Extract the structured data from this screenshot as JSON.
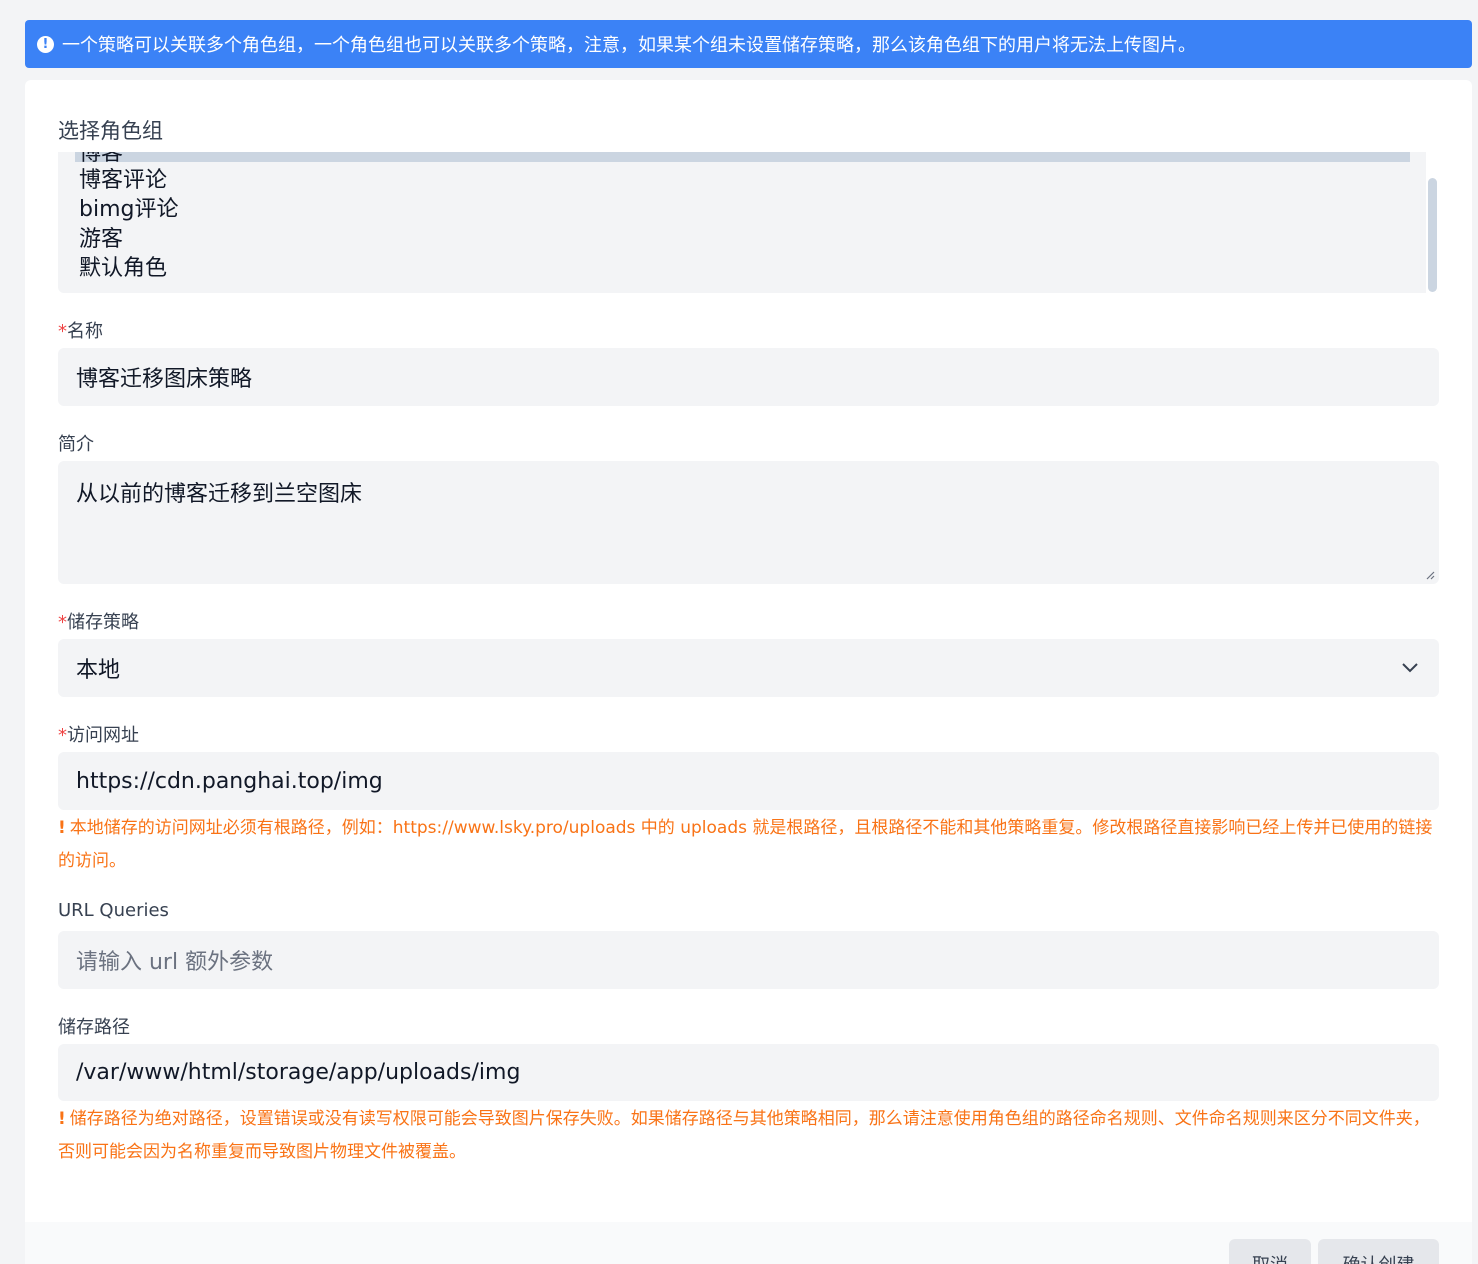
{
  "alert": {
    "icon": "exclamation-circle-icon",
    "text": "一个策略可以关联多个角色组，一个角色组也可以关联多个策略，注意，如果某个组未设置储存策略，那么该角色组下的用户将无法上传图片。"
  },
  "role_groups": {
    "label": "选择角色组",
    "partial_option": "博客",
    "options": [
      "博客评论",
      "bimg评论",
      "游客",
      "默认角色"
    ]
  },
  "name": {
    "required_mark": "*",
    "label": "名称",
    "value": "博客迁移图床策略"
  },
  "intro": {
    "label": "简介",
    "value": "从以前的博客迁移到兰空图床"
  },
  "storage": {
    "required_mark": "*",
    "label": "储存策略",
    "value": "本地",
    "icon": "chevron-down-icon"
  },
  "access_url": {
    "required_mark": "*",
    "label": "访问网址",
    "value": "https://cdn.panghai.top/img",
    "hint_mark": "!",
    "hint": "本地储存的访问网址必须有根路径，例如：https://www.lsky.pro/uploads 中的 uploads 就是根路径，且根路径不能和其他策略重复。修改根路径直接影响已经上传并已使用的链接的访问。"
  },
  "url_queries": {
    "label": "URL Queries",
    "placeholder": "请输入 url 额外参数"
  },
  "storage_path": {
    "label": "储存路径",
    "value": "/var/www/html/storage/app/uploads/img",
    "hint_mark": "!",
    "hint": "储存路径为绝对路径，设置错误或没有读写权限可能会导致图片保存失败。如果储存路径与其他策略相同，那么请注意使用角色组的路径命名规则、文件命名规则来区分不同文件夹，否则可能会因为名称重复而导致图片物理文件被覆盖。"
  },
  "footer": {
    "cancel_label": "取消",
    "confirm_label": "确认创建"
  },
  "colors": {
    "alert_bg": "#3b82f6",
    "hint": "#f97316",
    "required": "#ef4444",
    "field_bg": "#f3f4f6"
  }
}
